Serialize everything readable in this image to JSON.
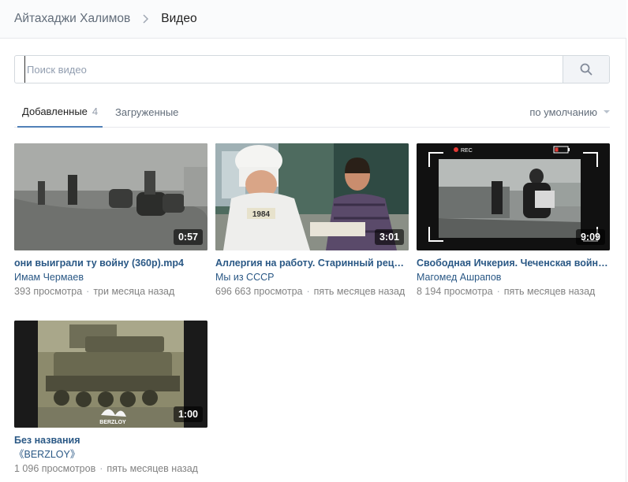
{
  "breadcrumb": {
    "owner": "Айтахаджи Халимов",
    "current": "Видео"
  },
  "search": {
    "placeholder": "Поиск видео",
    "value": ""
  },
  "tabs": [
    {
      "label": "Добавленные",
      "count": "4"
    },
    {
      "label": "Загруженные"
    }
  ],
  "sort": {
    "label": "по умолчанию"
  },
  "videos": [
    {
      "title": "они выиграли ту войну (360p).mp4",
      "author": "Имам Чермаев",
      "views": "393 просмотра",
      "date": "три месяца назад",
      "duration": "0:57"
    },
    {
      "title": "Аллергия на работу. Старинный рецепт…",
      "author": "Мы из СССР",
      "views": "696 663 просмотра",
      "date": "пять месяцев назад",
      "duration": "3:01"
    },
    {
      "title": "Свободная Ичкерия. Чеченская война.…",
      "author": "Магомед Ашрапов",
      "views": "8 194 просмотра",
      "date": "пять месяцев назад",
      "duration": "9:09"
    },
    {
      "title": "Без названия",
      "author": "《BERZLOY》",
      "views": "1 096 просмотров",
      "date": "пять месяцев назад",
      "duration": "1:00"
    }
  ],
  "overlays": {
    "rec_label": "REC",
    "sign_text": "1984",
    "watermark": "BERZLOY"
  }
}
